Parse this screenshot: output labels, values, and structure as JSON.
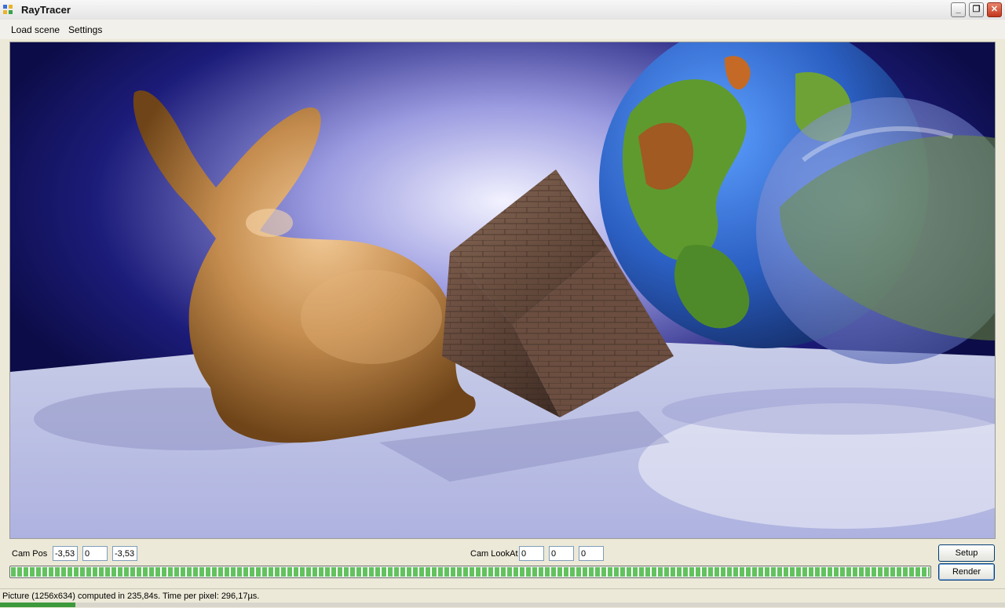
{
  "window": {
    "title": "RayTracer"
  },
  "title_buttons": {
    "minimize": "_",
    "restore": "❐",
    "close": "✕"
  },
  "menu": {
    "items": [
      {
        "label": "Load scene"
      },
      {
        "label": "Settings"
      }
    ]
  },
  "render_view": {
    "description_icon": "rendered-scene-image"
  },
  "camera": {
    "pos_label": "Cam Pos",
    "pos": {
      "x": "-3,53!",
      "y": "0",
      "z": "-3,53!"
    },
    "lookat_label": "Cam LookAt",
    "lookat": {
      "x": "0",
      "y": "0",
      "z": "0"
    }
  },
  "buttons": {
    "setup": "Setup",
    "render": "Render"
  },
  "progress": {
    "value": 1.0
  },
  "status": {
    "text": "Picture (1256x634) computed in 235,84s. Time per pixel: 296,17µs."
  },
  "colors": {
    "accent": "#62c25e",
    "close": "#c3381d"
  }
}
